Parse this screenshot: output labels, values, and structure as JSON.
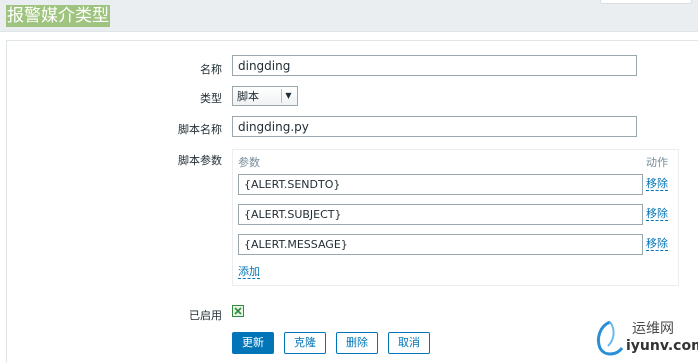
{
  "header": {
    "title": "报警媒介类型"
  },
  "form": {
    "name_label": "名称",
    "name_value": "dingding",
    "type_label": "类型",
    "type_value": "脚本",
    "script_name_label": "脚本名称",
    "script_name_value": "dingding.py",
    "script_params_label": "脚本参数",
    "enabled_label": "已启用",
    "enabled_checked": true
  },
  "params": {
    "col_param": "参数",
    "col_action": "动作",
    "rows": [
      {
        "value": "{ALERT.SENDTO}",
        "remove_label": "移除"
      },
      {
        "value": "{ALERT.SUBJECT}",
        "remove_label": "移除"
      },
      {
        "value": "{ALERT.MESSAGE}",
        "remove_label": "移除"
      }
    ],
    "add_label": "添加"
  },
  "buttons": {
    "update": "更新",
    "clone": "克隆",
    "delete": "删除",
    "cancel": "取消"
  },
  "watermark": {
    "cn": "运维网",
    "en": "iyunv.com"
  },
  "colors": {
    "accent": "#0275b8",
    "title_bg": "#9fc47f",
    "header_bg": "#ebeef0"
  }
}
